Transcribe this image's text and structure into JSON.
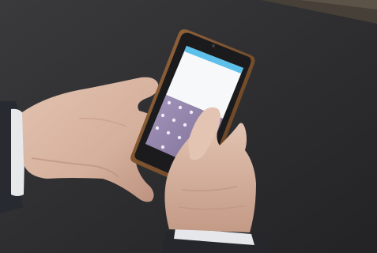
{
  "photo": {
    "colors": {
      "table": "#2f2f31",
      "table_edge": "#5a5146",
      "skin": "#d9b7a4",
      "skin_shadow": "#b88f7c",
      "sleeve_dark": "#2a2d33",
      "cuff_white": "#e9eaec",
      "phone_body": "#1b1b1d",
      "phone_frame": "#8a5a34",
      "screen_white": "#f8f9fb",
      "status_bar": "#5cc0ea",
      "keypad": "#8e7fa7"
    }
  }
}
